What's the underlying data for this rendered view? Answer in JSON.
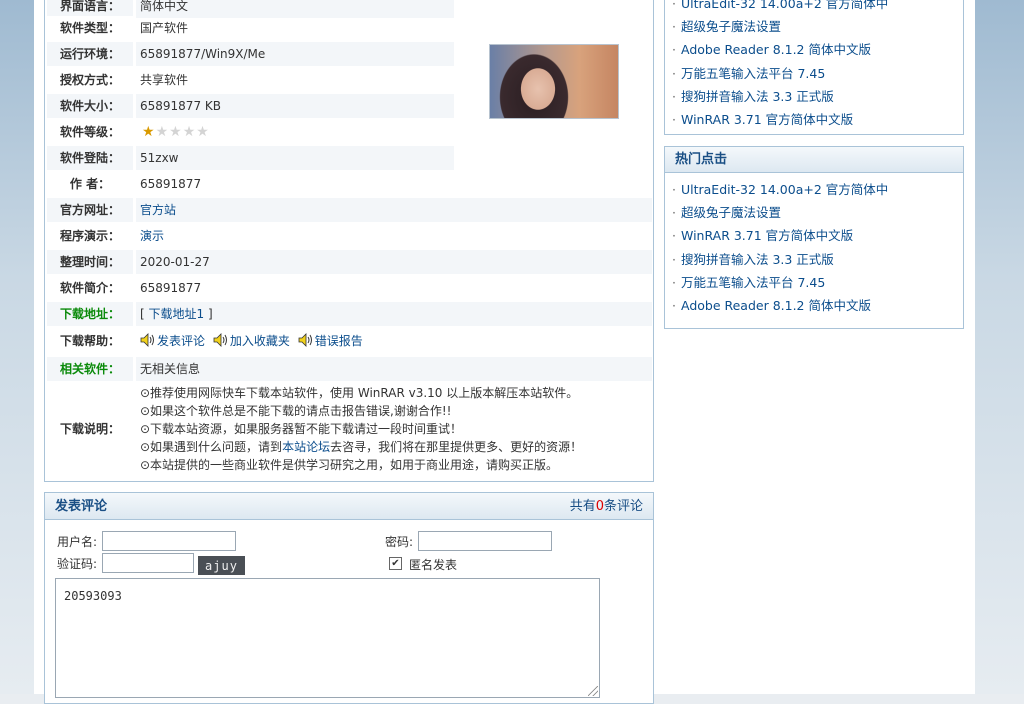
{
  "details": {
    "rows": [
      {
        "label": "界面语言：",
        "value": "简体中文"
      },
      {
        "label": "软件类型：",
        "value": "国产软件"
      },
      {
        "label": "运行环境：",
        "value": "65891877/Win9X/Me"
      },
      {
        "label": "授权方式：",
        "value": "共享软件"
      },
      {
        "label": "软件大小：",
        "value": "65891877 KB"
      },
      {
        "label": "软件等级：",
        "value": ""
      },
      {
        "label": "软件登陆：",
        "value": "51zxw"
      },
      {
        "label": "作 者：",
        "value": "65891877"
      },
      {
        "label": "官方网址：",
        "value": "官方站"
      },
      {
        "label": "程序演示：",
        "value": "演示"
      },
      {
        "label": "整理时间：",
        "value": "2020-01-27"
      },
      {
        "label": "软件简介：",
        "value": "65891877"
      },
      {
        "label": "下载地址：",
        "value": "下载地址1"
      },
      {
        "label": "下载帮助：",
        "value": ""
      },
      {
        "label": "相关软件：",
        "value": "无相关信息"
      },
      {
        "label": "下载说明：",
        "value": ""
      }
    ],
    "rating": {
      "filled": 1,
      "total": 5
    },
    "download_bracket_open": "[",
    "download_bracket_close": "]",
    "help_links": [
      "发表评论",
      "加入收藏夹",
      "错误报告"
    ],
    "notes": [
      "⊙推荐使用网际快车下载本站软件，使用 WinRAR v3.10 以上版本解压本站软件。",
      "⊙如果这个软件总是不能下载的请点击报告错误,谢谢合作!!",
      "⊙下载本站资源，如果服务器暂不能下载请过一段时间重试！",
      "⊙本站提供的一些商业软件是供学习研究之用，如用于商业用途，请购买正版。"
    ],
    "note4_prefix": "⊙如果遇到什么问题，请到",
    "note4_link": "本站论坛",
    "note4_suffix": "去咨寻，我们将在那里提供更多、更好的资源！"
  },
  "comment": {
    "title": "发表评论",
    "count_prefix": "共有",
    "count": "0",
    "count_suffix": "条评论",
    "username_label": "用户名:",
    "password_label": "密码:",
    "captcha_label": "验证码:",
    "captcha_text": "ajuy",
    "anonymous_label": "匿名发表",
    "anonymous_checked": true,
    "textarea_value": "20593093"
  },
  "sidebar": {
    "top_list": [
      "UltraEdit-32 14.00a+2 官方简体中",
      "超级兔子魔法设置",
      "Adobe Reader 8.1.2 简体中文版",
      "万能五笔输入法平台 7.45",
      "搜狗拼音输入法 3.3 正式版",
      "WinRAR 3.71 官方简体中文版"
    ],
    "hot": {
      "title": "热门点击",
      "items": [
        "UltraEdit-32 14.00a+2 官方简体中",
        "超级兔子魔法设置",
        "WinRAR 3.71 官方简体中文版",
        "搜狗拼音输入法 3.3 正式版",
        "万能五笔输入法平台 7.45",
        "Adobe Reader 8.1.2 简体中文版"
      ]
    }
  },
  "colors": {
    "link": "#0b4d8c",
    "label_green": "#0a8a0a",
    "count_red": "#dd0000",
    "box_border": "#a9c3d8"
  }
}
